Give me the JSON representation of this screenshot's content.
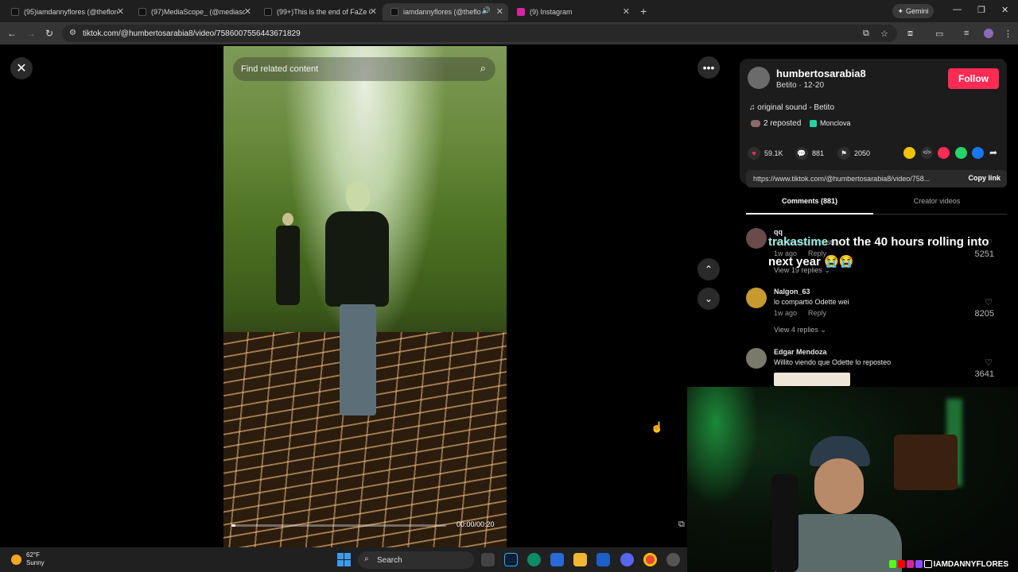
{
  "browser": {
    "tabs": [
      {
        "label": "(95)iamdannyflores (@theflores"
      },
      {
        "label": "(97)MediaScope_ (@mediascop"
      },
      {
        "label": "(99+)This is the end of FaZe Cla"
      },
      {
        "label": "iamdannyflores (@theflore"
      },
      {
        "label": "(9) Instagram"
      }
    ],
    "new_tab": "+",
    "gemini_label": "Gemini",
    "url": "tiktok.com/@humbertosarabia8/video/7586007556443671829"
  },
  "video": {
    "search_placeholder": "Find related content",
    "time": "00:00/00:20",
    "progress": 0.02
  },
  "author": {
    "username": "humbertosarabia8",
    "subtitle": "Betito · 12-20",
    "follow_label": "Follow",
    "sound": "original sound - Betito",
    "reposted": "2 reposted",
    "location": "Monclova"
  },
  "stats": {
    "likes": "59.1K",
    "comments": "881",
    "saves": "2050"
  },
  "link": {
    "url": "https://www.tiktok.com/@humbertosarabia8/video/758...",
    "copy_label": "Copy link"
  },
  "tabs": {
    "comments": "Comments (881)",
    "creator": "Creator videos"
  },
  "comments": [
    {
      "user": "qq",
      "text": "no wtaebas repost lol",
      "meta": "1w ago",
      "reply": "Reply",
      "likes": "5251",
      "view_replies": "View 19 replies"
    },
    {
      "user": "Nalgon_63",
      "text": "lo compartió Odette wei",
      "meta": "1w ago",
      "reply": "Reply",
      "likes": "8205",
      "view_replies": "View 4 replies"
    },
    {
      "user": "Edgar Mendoza",
      "text": "Willito viendo que Odette lo reposteo",
      "meta": "",
      "reply": "",
      "likes": "3641",
      "view_replies": ""
    }
  ],
  "overlay": {
    "accent": "trakastime",
    "text": " not the 40 hours rolling into next year 😭😭"
  },
  "webcam": {
    "handle": "IAMDANNYFLORES"
  },
  "taskbar": {
    "temp": "62°F",
    "condition": "Sunny",
    "search_label": "Search"
  },
  "colors": {
    "follow": "#fe2c55",
    "accent_text": "#9ff0e6"
  }
}
